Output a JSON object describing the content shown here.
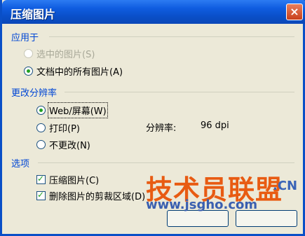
{
  "window": {
    "title": "压缩图片",
    "close_icon": "×"
  },
  "apply_to": {
    "label": "应用于",
    "options": [
      {
        "label": "选中的图片(S)",
        "checked": false,
        "enabled": false
      },
      {
        "label": "文档中的所有图片(A)",
        "checked": true,
        "enabled": true
      }
    ]
  },
  "resolution": {
    "label": "更改分辨率",
    "options": [
      {
        "label": "Web/屏幕(W)",
        "checked": true
      },
      {
        "label": "打印(P)",
        "checked": false
      },
      {
        "label": "不更改(N)",
        "checked": false
      }
    ],
    "info_label": "分辨率:",
    "info_value": "96 dpi"
  },
  "options": {
    "label": "选项",
    "items": [
      {
        "label": "压缩图片(C)",
        "checked": true
      },
      {
        "label": "删除图片的剪裁区域(D)",
        "checked": true
      }
    ]
  },
  "watermark": {
    "brand": "技术员联盟",
    "suffix": ".CN",
    "url": "www.jsgho.com"
  }
}
